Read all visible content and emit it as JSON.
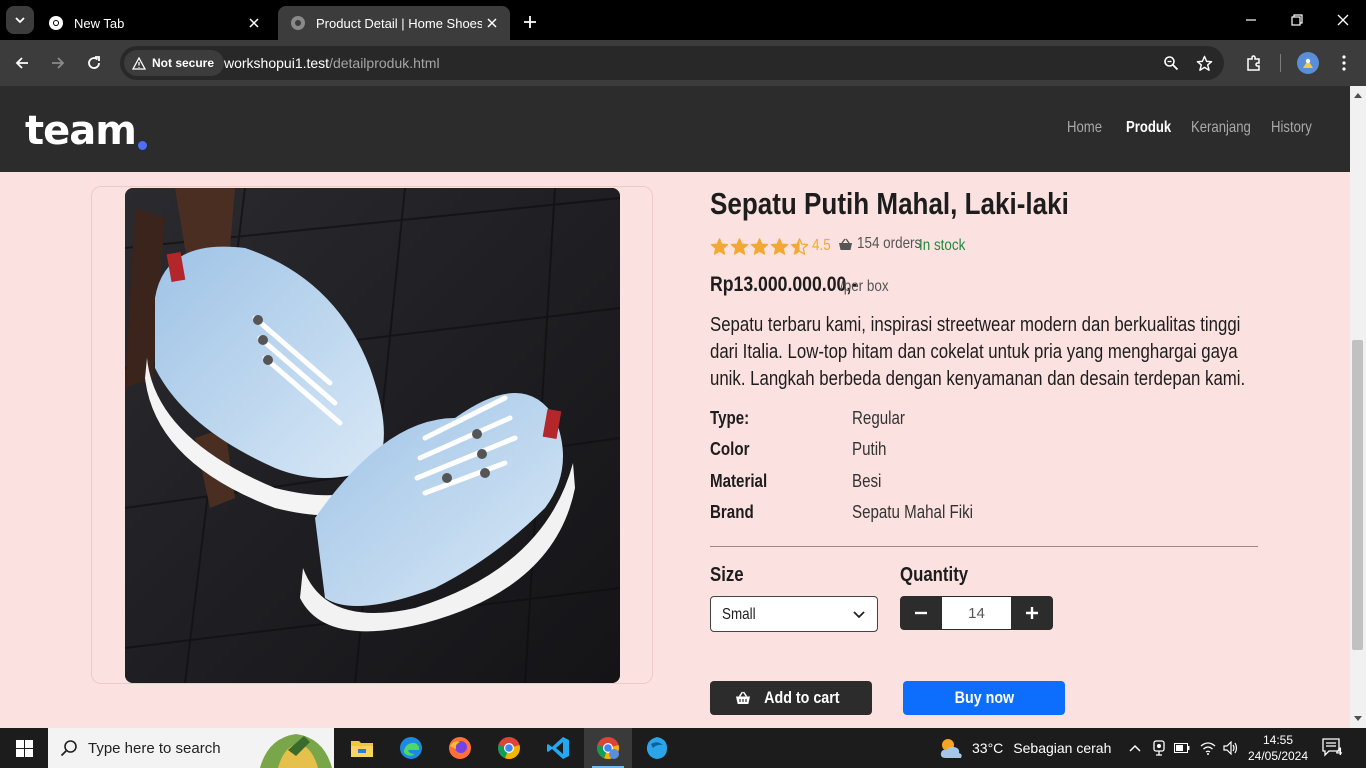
{
  "browser": {
    "tabs": [
      {
        "title": "New Tab",
        "active": false
      },
      {
        "title": "Product Detail | Home Shoes",
        "active": true
      }
    ],
    "security_label": "Not secure",
    "url_host": "workshopui1.test",
    "url_path": "/detailproduk.html"
  },
  "site": {
    "logo": "team",
    "nav": [
      {
        "label": "Home",
        "active": false
      },
      {
        "label": "Produk",
        "active": true
      },
      {
        "label": "Keranjang",
        "active": false
      },
      {
        "label": "History",
        "active": false
      }
    ]
  },
  "product": {
    "title": "Sepatu Putih Mahal, Laki-laki",
    "rating": "4.5",
    "rating_value": 4.5,
    "orders": "154 orders",
    "stock": "In stock",
    "price": "Rp13.000.000.00,-",
    "price_unit": "/per box",
    "description": "Sepatu terbaru kami, inspirasi streetwear modern dan berkualitas tinggi dari Italia. Low-top hitam dan cokelat untuk pria yang menghargai gaya unik. Langkah berbeda dengan kenyamanan dan desain terdepan kami.",
    "specs": [
      {
        "key": "Type:",
        "value": "Regular"
      },
      {
        "key": "Color",
        "value": "Putih"
      },
      {
        "key": "Material",
        "value": "Besi"
      },
      {
        "key": "Brand",
        "value": "Sepatu Mahal Fiki"
      }
    ],
    "size_label": "Size",
    "size_selected": "Small",
    "quantity_label": "Quantity",
    "quantity": "14",
    "add_to_cart": "Add to cart",
    "buy_now": "Buy now"
  },
  "taskbar": {
    "search_placeholder": "Type here to search",
    "weather_temp": "33°C",
    "weather_desc": "Sebagian cerah",
    "time": "14:55",
    "date": "24/05/2024",
    "notification_count": "4"
  },
  "colors": {
    "page_bg": "#fbe2e1",
    "header_bg": "#2d2c2c",
    "buy_button": "#0d6efd",
    "stock_green": "#1a8c3c",
    "star": "#f3a833"
  }
}
